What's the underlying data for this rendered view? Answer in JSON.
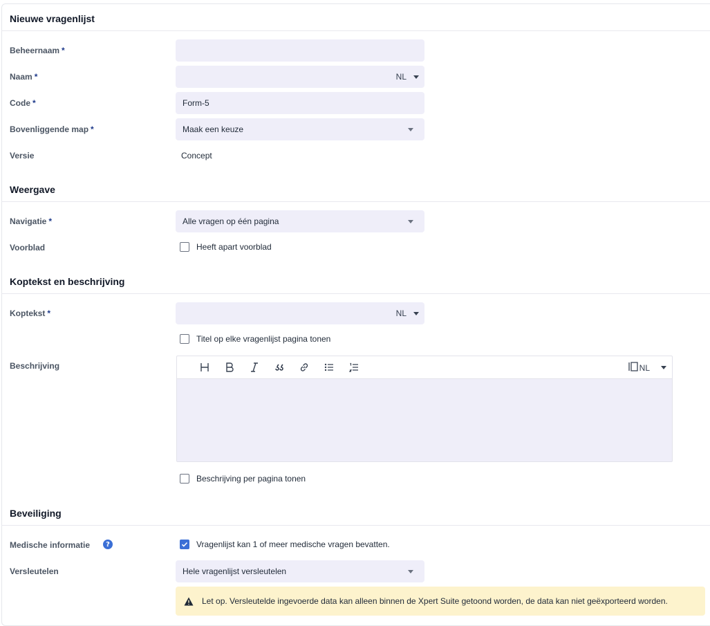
{
  "sections": {
    "general": "Nieuwe vragenlijst",
    "display": "Weergave",
    "header": "Koptekst en beschrijving",
    "security": "Beveiliging"
  },
  "fields": {
    "admin_name": {
      "label": "Beheernaam",
      "required": "*",
      "value": ""
    },
    "name": {
      "label": "Naam",
      "required": "*",
      "value": "",
      "lang": "NL"
    },
    "code": {
      "label": "Code",
      "required": "*",
      "value": "Form-5"
    },
    "parent_folder": {
      "label": "Bovenliggende map",
      "required": "*",
      "value": "Maak een keuze"
    },
    "version": {
      "label": "Versie",
      "value": "Concept"
    },
    "navigation": {
      "label": "Navigatie",
      "required": "*",
      "value": "Alle vragen op één pagina"
    },
    "cover": {
      "label": "Voorblad",
      "checkbox_label": "Heeft apart voorblad",
      "checked": false
    },
    "header_text": {
      "label": "Koptekst",
      "required": "*",
      "value": "",
      "lang": "NL"
    },
    "title_each_page": {
      "checkbox_label": "Titel op elke vragenlijst pagina tonen",
      "checked": false
    },
    "description": {
      "label": "Beschrijving",
      "lang": "NL",
      "value": ""
    },
    "description_per_page": {
      "checkbox_label": "Beschrijving per pagina tonen",
      "checked": false
    },
    "medical_info": {
      "label": "Medische informatie",
      "checkbox_label": "Vragenlijst kan 1 of meer medische vragen bevatten.",
      "checked": true
    },
    "encrypt": {
      "label": "Versleutelen",
      "value": "Hele vragenlijst versleutelen"
    }
  },
  "editor_toolbar": [
    "heading-icon",
    "bold-icon",
    "italic-icon",
    "quote-icon",
    "link-icon",
    "bullet-list-icon",
    "numbered-list-icon"
  ],
  "warning": {
    "icon": "warning-icon",
    "text": "Let op. Versleutelde ingevoerde data kan alleen binnen de Xpert Suite getoond worden, de data kan niet geëxporteerd worden."
  },
  "colors": {
    "field_bg": "#efeef9",
    "accent": "#3b6fd6",
    "warning_bg": "#fdf3cd"
  }
}
